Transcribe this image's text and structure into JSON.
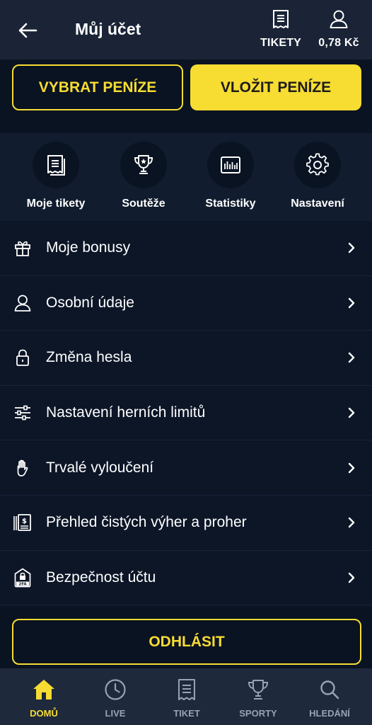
{
  "header": {
    "title": "Můj účet",
    "tickets_label": "TIKETY",
    "balance": "0,78 Kč"
  },
  "actions": {
    "withdraw_label": "VYBRAT PENÍZE",
    "deposit_label": "VLOŽIT PENÍZE"
  },
  "quick_links": [
    {
      "label": "Moje tikety",
      "icon": "ticket-icon"
    },
    {
      "label": "Soutěže",
      "icon": "trophy-icon"
    },
    {
      "label": "Statistiky",
      "icon": "statistics-icon"
    },
    {
      "label": "Nastavení",
      "icon": "gear-icon"
    }
  ],
  "menu": [
    {
      "label": "Moje bonusy",
      "icon": "gift-icon"
    },
    {
      "label": "Osobní údaje",
      "icon": "user-icon"
    },
    {
      "label": "Změna hesla",
      "icon": "lock-icon"
    },
    {
      "label": "Nastavení herních limitů",
      "icon": "sliders-icon"
    },
    {
      "label": "Trvalé vyloučení",
      "icon": "hand-icon"
    },
    {
      "label": "Přehled čistých výher a proher",
      "icon": "money-report-icon"
    },
    {
      "label": "Bezpečnost účtu",
      "icon": "2fa-lock-icon",
      "icon_text": "2FA"
    }
  ],
  "logout_label": "ODHLÁSIT",
  "bottom_nav": [
    {
      "label": "DOMŮ",
      "icon": "home-icon",
      "active": true
    },
    {
      "label": "LIVE",
      "icon": "clock-icon",
      "active": false
    },
    {
      "label": "TIKET",
      "icon": "ticket-icon",
      "active": false
    },
    {
      "label": "SPORTY",
      "icon": "trophy-icon",
      "active": false
    },
    {
      "label": "HLEDÁNÍ",
      "icon": "search-icon",
      "active": false
    }
  ],
  "colors": {
    "accent": "#f7dc32",
    "background": "#0c1627",
    "header": "#1a2436",
    "nav_inactive": "#98a2b3"
  }
}
